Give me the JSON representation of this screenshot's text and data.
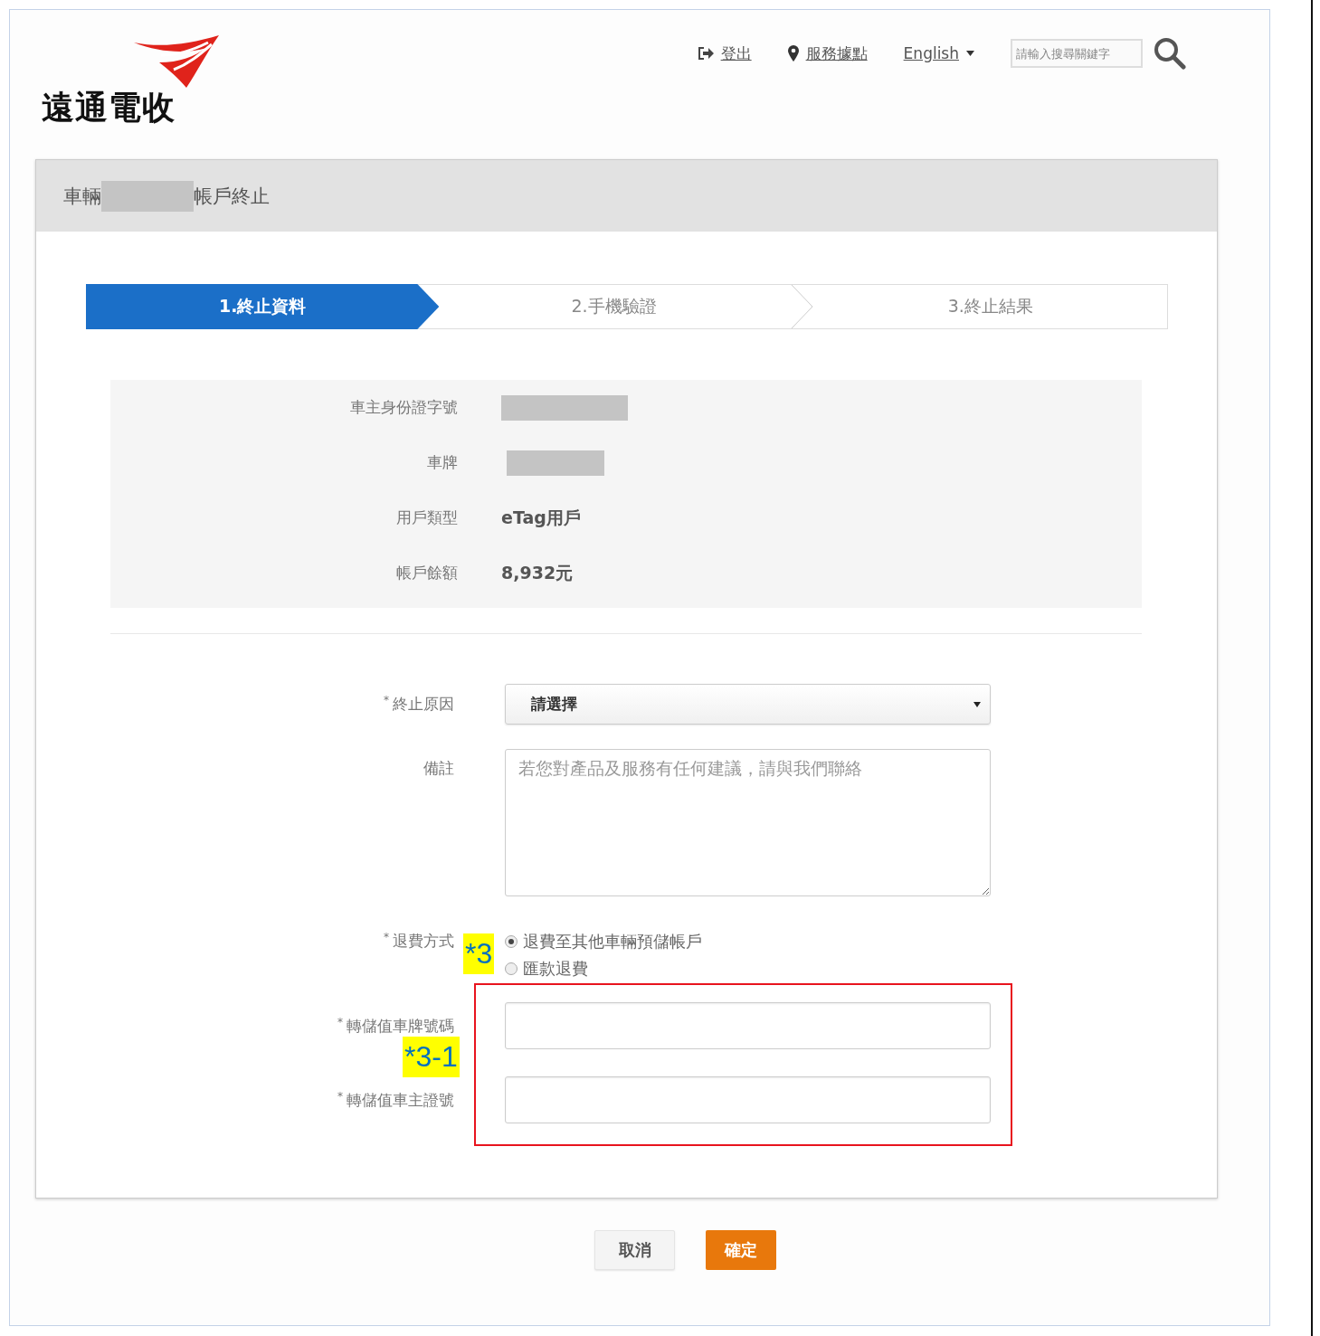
{
  "logo": {
    "text": "遠通電收"
  },
  "nav": [
    {
      "kind": "logout",
      "label": "登出"
    },
    {
      "kind": "location",
      "label": "服務據點"
    },
    {
      "kind": "language",
      "label": "English"
    }
  ],
  "search": {
    "placeholder": "請輸入搜尋關鍵字"
  },
  "card": {
    "title_prefix": "車輛",
    "title_suffix": "帳戶終止"
  },
  "steps": [
    {
      "label": "1.終止資料",
      "selected": true
    },
    {
      "label": "2.手機驗證",
      "selected": false
    },
    {
      "label": "3.終止結果",
      "selected": false
    }
  ],
  "info": [
    {
      "kind": "redacted",
      "label": "車主身份證字號"
    },
    {
      "kind": "redacted",
      "label": "車牌"
    },
    {
      "kind": "text",
      "label": "用戶類型",
      "value": "eTag用戶"
    },
    {
      "kind": "text",
      "label": "帳戶餘額",
      "value": "8,932元"
    }
  ],
  "fields": [
    {
      "kind": "select",
      "mark": "*",
      "label": "終止原因",
      "value": "請選擇"
    },
    {
      "kind": "textarea",
      "label": "備註",
      "placeholder": "若您對產品及服務有任何建議，請與我們聯絡"
    },
    {
      "kind": "radio",
      "mark": "*",
      "label": "退費方式",
      "callout": "*3",
      "options": [
        {
          "label": "退費至其他車輛預儲帳戶",
          "selected": true
        },
        {
          "label": "匯款退費",
          "selected": false
        }
      ]
    },
    {
      "kind": "text",
      "mark": "*",
      "label": "轉儲值車牌號碼"
    },
    {
      "kind": "text",
      "mark": "*",
      "label": "轉儲值車主證號"
    }
  ],
  "highlight": {
    "callout": "*3-1"
  },
  "buttons": [
    {
      "kind": "secondary",
      "label": "取消"
    },
    {
      "kind": "primary",
      "label": "確定"
    }
  ]
}
